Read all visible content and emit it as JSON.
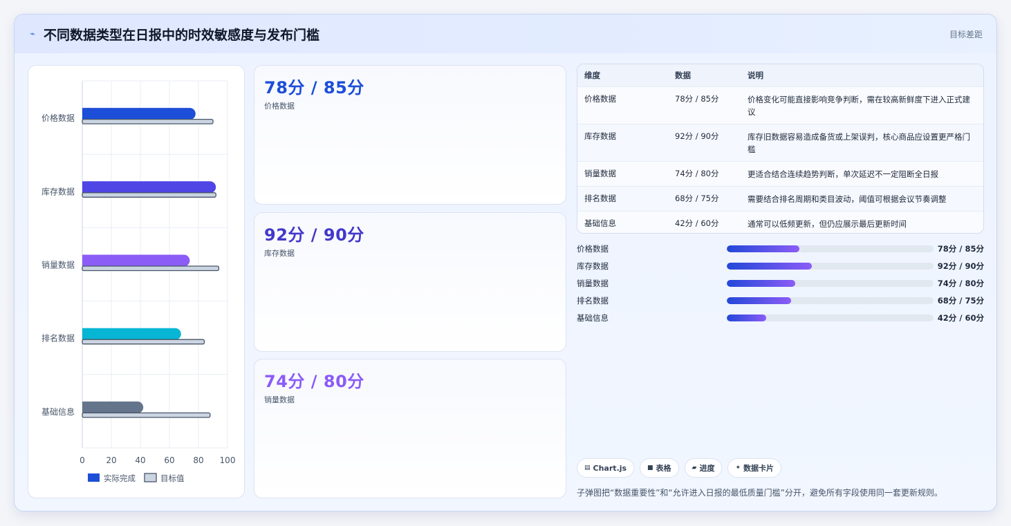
{
  "header": {
    "title": "不同数据类型在日报中的时效敏感度与发布门槛",
    "right": "目标差距",
    "logo_icon": "pulse-icon"
  },
  "chart_data": {
    "type": "bar",
    "orientation": "horizontal",
    "categories": [
      "价格数据",
      "库存数据",
      "销量数据",
      "排名数据",
      "基础信息"
    ],
    "series": [
      {
        "name": "实际完成",
        "values": [
          78,
          92,
          74,
          68,
          42
        ],
        "colors": [
          "#1d4ed8",
          "#4f46e5",
          "#8b5cf6",
          "#06b6d4",
          "#64748b"
        ]
      },
      {
        "name": "目标值",
        "values": [
          90,
          92,
          94,
          84,
          88
        ],
        "color": "#cbd5e1",
        "border": "#475569"
      }
    ],
    "xlim": [
      0,
      100
    ],
    "xticks": [
      "0",
      "20",
      "40",
      "60",
      "80",
      "100"
    ],
    "grid": true,
    "legend": "bottom"
  },
  "kpis": [
    {
      "value": "78分 / 85分",
      "label": "价格数据",
      "color": "#1d4ed8"
    },
    {
      "value": "92分 / 90分",
      "label": "库存数据",
      "color": "#4338ca"
    },
    {
      "value": "74分 / 80分",
      "label": "销量数据",
      "color": "#8b5cf6"
    }
  ],
  "table": {
    "headers": [
      "维度",
      "数据",
      "说明"
    ],
    "rows": [
      [
        "价格数据",
        "78分 / 85分",
        "价格变化可能直接影响竞争判断，需在较高新鲜度下进入正式建议"
      ],
      [
        "库存数据",
        "92分 / 90分",
        "库存旧数据容易造成备货或上架误判，核心商品应设置更严格门槛"
      ],
      [
        "销量数据",
        "74分 / 80分",
        "更适合结合连续趋势判断，单次延迟不一定阻断全日报"
      ],
      [
        "排名数据",
        "68分 / 75分",
        "需要结合排名周期和类目波动，阈值可根据会议节奏调整"
      ],
      [
        "基础信息",
        "42分 / 60分",
        "通常可以低频更新，但仍应展示最后更新时间"
      ]
    ]
  },
  "progress": [
    {
      "name": "价格数据",
      "value": "78分 / 85分",
      "fill": 0.35
    },
    {
      "name": "库存数据",
      "value": "92分 / 90分",
      "fill": 0.41
    },
    {
      "name": "销量数据",
      "value": "74分 / 80分",
      "fill": 0.33
    },
    {
      "name": "排名数据",
      "value": "68分 / 75分",
      "fill": 0.31
    },
    {
      "name": "基础信息",
      "value": "42分 / 60分",
      "fill": 0.19
    }
  ],
  "chips": [
    {
      "icon": "chart-icon",
      "glyph": "▤",
      "label": "Chart.js"
    },
    {
      "icon": "table-icon",
      "glyph": "■",
      "label": "表格"
    },
    {
      "icon": "progress-icon",
      "glyph": "▰",
      "label": "进度"
    },
    {
      "icon": "sparkle-icon",
      "glyph": "✦",
      "label": "数据卡片"
    }
  ],
  "footnote": "子弹图把“数据重要性”和“允许进入日报的最低质量门槛”分开，避免所有字段使用同一套更新规则。"
}
